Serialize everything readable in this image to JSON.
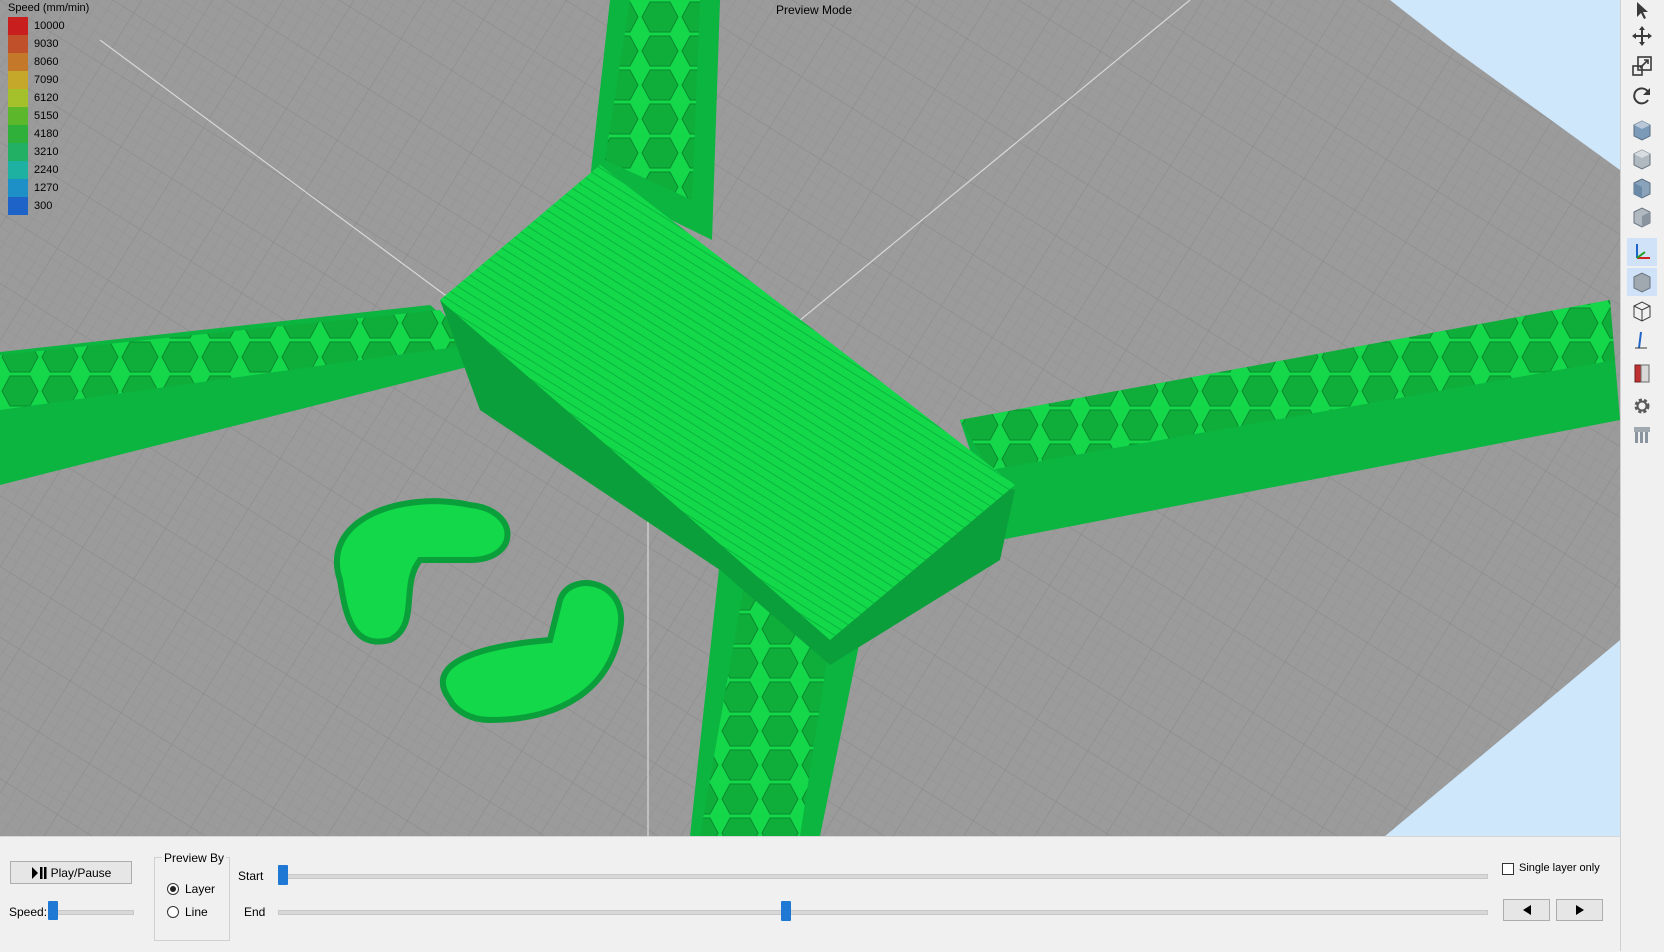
{
  "viewport": {
    "mode_label": "Preview Mode",
    "legend": {
      "title": "Speed (mm/min)",
      "items": [
        {
          "value": "10000",
          "color": "#c81e1e"
        },
        {
          "value": "9030",
          "color": "#c0502a"
        },
        {
          "value": "8060",
          "color": "#c3782a"
        },
        {
          "value": "7090",
          "color": "#c5a82a"
        },
        {
          "value": "6120",
          "color": "#a4c02a"
        },
        {
          "value": "5150",
          "color": "#5cb82a"
        },
        {
          "value": "4180",
          "color": "#2eb03a"
        },
        {
          "value": "3210",
          "color": "#22b065"
        },
        {
          "value": "2240",
          "color": "#1eb0a0"
        },
        {
          "value": "1270",
          "color": "#1e90c8"
        },
        {
          "value": "300",
          "color": "#1e64c8"
        }
      ]
    },
    "colors": {
      "bed": "#9b9b9b",
      "model": "#10d848",
      "model_dark": "#0aa83a",
      "sky": "#cfe7fb"
    }
  },
  "toolbar": {
    "tools": [
      {
        "name": "select-tool-icon"
      },
      {
        "name": "move-tool-icon"
      },
      {
        "name": "scale-tool-icon"
      },
      {
        "name": "rotate-tool-icon"
      },
      {
        "name": "view-front-icon"
      },
      {
        "name": "view-back-icon"
      },
      {
        "name": "view-left-icon"
      },
      {
        "name": "view-right-icon"
      },
      {
        "name": "axes-icon"
      },
      {
        "name": "solid-view-icon"
      },
      {
        "name": "wireframe-view-icon"
      },
      {
        "name": "z-axis-icon"
      },
      {
        "name": "cross-section-icon"
      },
      {
        "name": "settings-gear-icon"
      },
      {
        "name": "support-tool-icon"
      }
    ]
  },
  "controls": {
    "play_pause_label": "Play/Pause",
    "speed_label": "Speed:",
    "preview_by": {
      "title": "Preview By",
      "options": [
        "Layer",
        "Line"
      ],
      "selected": "Layer"
    },
    "start_label": "Start",
    "end_label": "End",
    "start_position": 0.0,
    "end_position": 0.42,
    "speed_position": 0.0,
    "single_layer_label": "Single layer only",
    "single_layer_checked": false,
    "prev_icon": "prev-arrow-icon",
    "next_icon": "next-arrow-icon"
  }
}
